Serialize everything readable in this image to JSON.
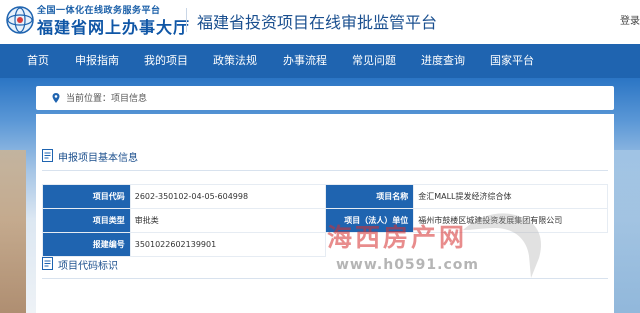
{
  "header": {
    "logo_top": "全国一体化在线政务服务平台",
    "logo_main": "福建省网上办事大厅",
    "title": "福建省投资项目在线审批监管平台",
    "login": "登录"
  },
  "nav": {
    "items": [
      "首页",
      "申报指南",
      "我的项目",
      "政策法规",
      "办事流程",
      "常见问题",
      "进度查询",
      "国家平台"
    ]
  },
  "breadcrumb": {
    "text": "当前位置：项目信息"
  },
  "section_basic": {
    "title": "申报项目基本信息"
  },
  "project": {
    "code_label": "项目代码",
    "code_value": "2602-350102-04-05-604998",
    "name_label": "项目名称",
    "name_value": "金汇MALL提发经济综合体",
    "type_label": "项目类型",
    "type_value": "审批类",
    "unit_label": "项目（法人）单位",
    "unit_value": "福州市鼓楼区城建投资发展集团有限公司",
    "report_label": "报建编号",
    "report_value": "3501022602139901"
  },
  "section_code": {
    "title": "项目代码标识"
  },
  "watermark": {
    "brand": "海西房产网",
    "url": "www.h0591.com"
  },
  "colors": {
    "nav_blue": "#1f64b0",
    "title_blue": "#1a4f8f",
    "label_bg": "#1f64b0"
  }
}
